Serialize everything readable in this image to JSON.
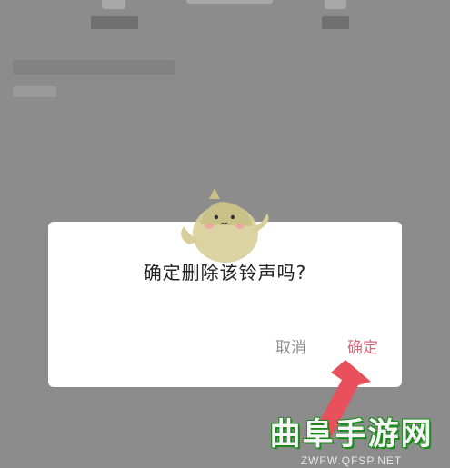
{
  "dialog": {
    "message": "确定删除该铃声吗?",
    "cancel_label": "取消",
    "confirm_label": "确定"
  },
  "watermark": {
    "title": "曲阜手游网",
    "url": "ZWFW.QFSP.NET"
  },
  "colors": {
    "accent": "#d46a7c",
    "cancel_text": "#8c8c8c",
    "overlay": "#8c8c8c",
    "arrow": "#e8505b",
    "watermark_outline": "#1a8a1a"
  },
  "icons": [
    "mascot-icon",
    "pointer-arrow-icon"
  ]
}
